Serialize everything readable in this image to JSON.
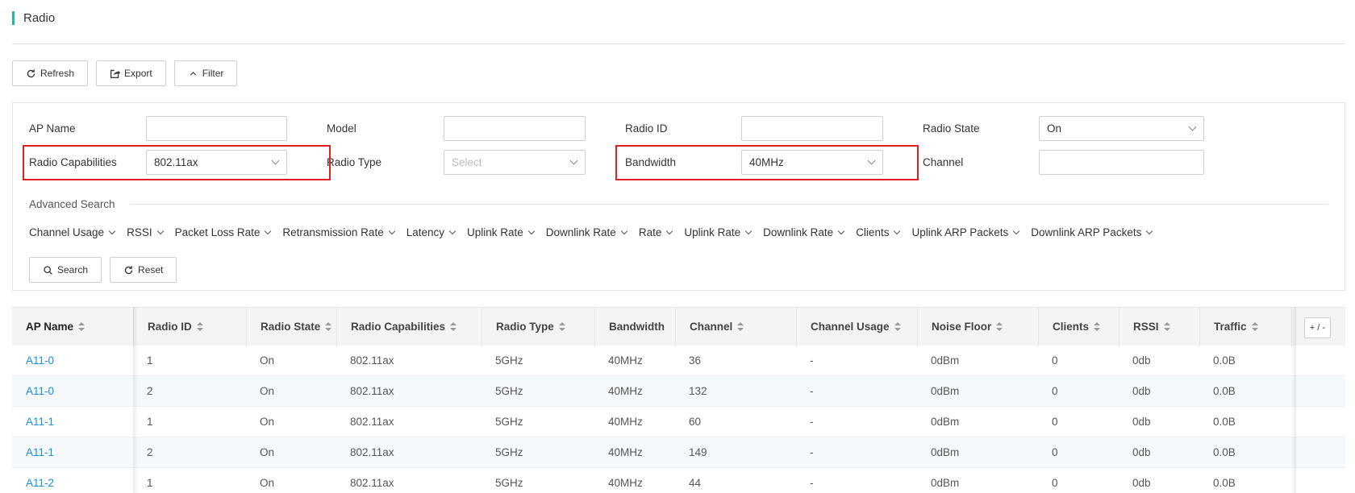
{
  "header": {
    "title": "Radio"
  },
  "toolbar": {
    "refresh": "Refresh",
    "export": "Export",
    "filter": "Filter"
  },
  "filters": {
    "ap_name": {
      "label": "AP Name",
      "value": ""
    },
    "model": {
      "label": "Model",
      "value": ""
    },
    "radio_id": {
      "label": "Radio ID",
      "value": ""
    },
    "radio_state": {
      "label": "Radio State",
      "value": "On"
    },
    "radio_capabilities": {
      "label": "Radio Capabilities",
      "value": "802.11ax"
    },
    "radio_type": {
      "label": "Radio Type",
      "placeholder": "Select"
    },
    "bandwidth": {
      "label": "Bandwidth",
      "value": "40MHz"
    },
    "channel": {
      "label": "Channel",
      "value": ""
    }
  },
  "advanced": {
    "label": "Advanced Search",
    "metrics": [
      "Channel Usage",
      "RSSI",
      "Packet Loss Rate",
      "Retransmission Rate",
      "Latency",
      "Uplink Rate",
      "Downlink Rate",
      "Rate",
      "Uplink Rate",
      "Downlink Rate",
      "Clients",
      "Uplink ARP Packets",
      "Downlink ARP Packets"
    ],
    "search": "Search",
    "reset": "Reset"
  },
  "table": {
    "columns": [
      "AP Name",
      "Radio ID",
      "Radio State",
      "Radio Capabilities",
      "Radio Type",
      "Bandwidth",
      "Channel",
      "Channel Usage",
      "Noise Floor",
      "Clients",
      "RSSI",
      "Traffic"
    ],
    "column_toggle": "+ / -",
    "rows": [
      [
        "A11-0",
        "1",
        "On",
        "802.11ax",
        "5GHz",
        "40MHz",
        "36",
        "-",
        "0dBm",
        "0",
        "0db",
        "0.0B"
      ],
      [
        "A11-0",
        "2",
        "On",
        "802.11ax",
        "5GHz",
        "40MHz",
        "132",
        "-",
        "0dBm",
        "0",
        "0db",
        "0.0B"
      ],
      [
        "A11-1",
        "1",
        "On",
        "802.11ax",
        "5GHz",
        "40MHz",
        "60",
        "-",
        "0dBm",
        "0",
        "0db",
        "0.0B"
      ],
      [
        "A11-1",
        "2",
        "On",
        "802.11ax",
        "5GHz",
        "40MHz",
        "149",
        "-",
        "0dBm",
        "0",
        "0db",
        "0.0B"
      ],
      [
        "A11-2",
        "1",
        "On",
        "802.11ax",
        "5GHz",
        "40MHz",
        "44",
        "-",
        "0dBm",
        "0",
        "0db",
        "0.0B"
      ]
    ]
  },
  "colors": {
    "accent": "#1abc9c",
    "link": "#1a8ee0",
    "highlight": "#e02020"
  }
}
